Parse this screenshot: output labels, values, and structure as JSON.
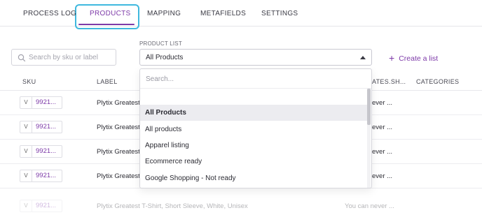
{
  "tabs": [
    {
      "label": "PROCESS LOG"
    },
    {
      "label": "PRODUCTS"
    },
    {
      "label": "MAPPING"
    },
    {
      "label": "METAFIELDS"
    },
    {
      "label": "SETTINGS"
    }
  ],
  "active_tab": "PRODUCTS",
  "search": {
    "placeholder": "Search by sku or label",
    "icon": "search-icon"
  },
  "product_list": {
    "label": "PRODUCT LIST",
    "selected": "All Products",
    "search_placeholder": "Search...",
    "options": [
      "All Products",
      "All products",
      "Apparel listing",
      "Ecommerce ready",
      "Google Shopping - Not ready"
    ]
  },
  "create_list": {
    "icon": "plus-icon",
    "label": "Create a list"
  },
  "table": {
    "headers": {
      "sku": "SKU",
      "label": "LABEL",
      "attribute": "ATES.SH...",
      "categories": "CATEGORIES"
    },
    "rows": [
      {
        "v": "V",
        "sku": "9921...",
        "label": "Plytix Greatest",
        "attr": "ever ..."
      },
      {
        "v": "V",
        "sku": "9921...",
        "label": "Plytix Greatest",
        "attr": "ever ..."
      },
      {
        "v": "V",
        "sku": "9921...",
        "label": "Plytix Greatest",
        "attr": "ever ..."
      },
      {
        "v": "V",
        "sku": "9921...",
        "label": "Plytix Greatest",
        "attr": "ever ..."
      }
    ],
    "partial_row": {
      "v": "V",
      "sku": "9921...",
      "label": "Plytix Greatest T-Shirt, Short Sleeve, White, Unisex",
      "attr": "You can never ..."
    }
  },
  "colors": {
    "accent": "#7d3aa8",
    "focus_ring": "#3fb8de",
    "selected_option_bg": "#ececf0"
  }
}
